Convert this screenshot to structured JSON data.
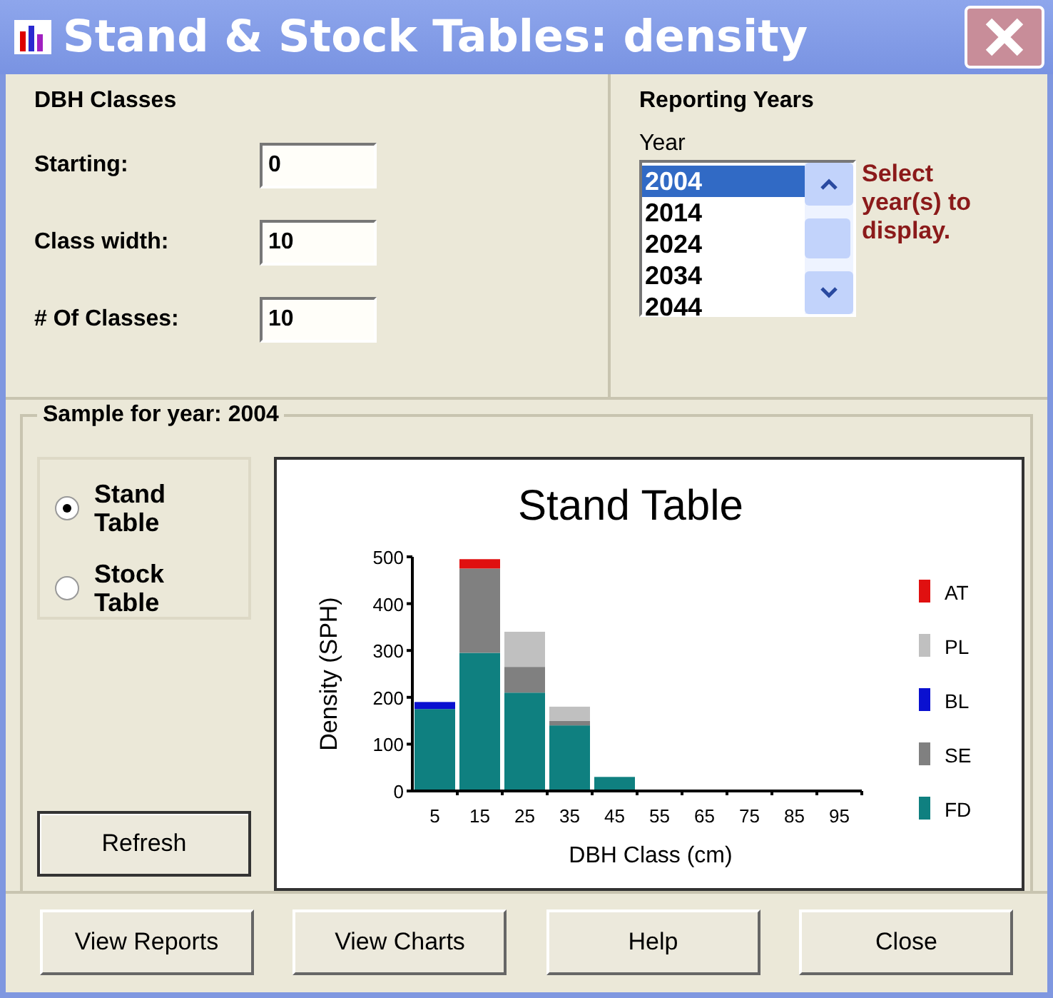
{
  "window": {
    "title": "Stand & Stock Tables: density"
  },
  "dbh_classes": {
    "title": "DBH Classes",
    "fields": [
      {
        "label": "Starting:",
        "value": "0"
      },
      {
        "label": "Class width:",
        "value": "10"
      },
      {
        "label": "# Of Classes:",
        "value": "10"
      }
    ]
  },
  "reporting_years": {
    "title": "Reporting Years",
    "list_label": "Year",
    "years": [
      {
        "label": "2004",
        "selected": true
      },
      {
        "label": "2014",
        "selected": false
      },
      {
        "label": "2024",
        "selected": false
      },
      {
        "label": "2034",
        "selected": false
      },
      {
        "label": "2044",
        "selected": false
      }
    ],
    "hint": "Select year(s) to display."
  },
  "sample": {
    "title": "Sample for year: 2004",
    "options": [
      {
        "label": "Stand Table",
        "selected": true
      },
      {
        "label": "Stock Table",
        "selected": false
      }
    ],
    "refresh_button": "Refresh",
    "chart_data": {
      "type": "bar",
      "title": "Stand Table",
      "xlabel": "DBH Class (cm)",
      "ylabel": "Density (SPH)",
      "stacked": true,
      "legend": true,
      "categories": [
        "5",
        "15",
        "25",
        "35",
        "45",
        "55",
        "65",
        "75",
        "85",
        "95"
      ],
      "ylim": [
        0,
        500
      ],
      "yticks": [
        0,
        100,
        200,
        300,
        400,
        500
      ],
      "series": [
        {
          "name": "AT",
          "color": "#e01010",
          "values": [
            0,
            20,
            0,
            0,
            0,
            0,
            0,
            0,
            0,
            0
          ]
        },
        {
          "name": "PL",
          "color": "#c0c0c0",
          "values": [
            0,
            0,
            75,
            30,
            0,
            0,
            0,
            0,
            0,
            0
          ]
        },
        {
          "name": "BL",
          "color": "#0a10d0",
          "values": [
            15,
            0,
            0,
            0,
            0,
            0,
            0,
            0,
            0,
            0
          ]
        },
        {
          "name": "SE",
          "color": "#808080",
          "values": [
            0,
            180,
            55,
            10,
            0,
            0,
            0,
            0,
            0,
            0
          ]
        },
        {
          "name": "FD",
          "color": "#0f8080",
          "values": [
            175,
            295,
            210,
            140,
            30,
            0,
            0,
            0,
            0,
            0
          ]
        }
      ]
    }
  },
  "buttons": [
    "View Reports",
    "View Charts",
    "Help",
    "Close"
  ]
}
